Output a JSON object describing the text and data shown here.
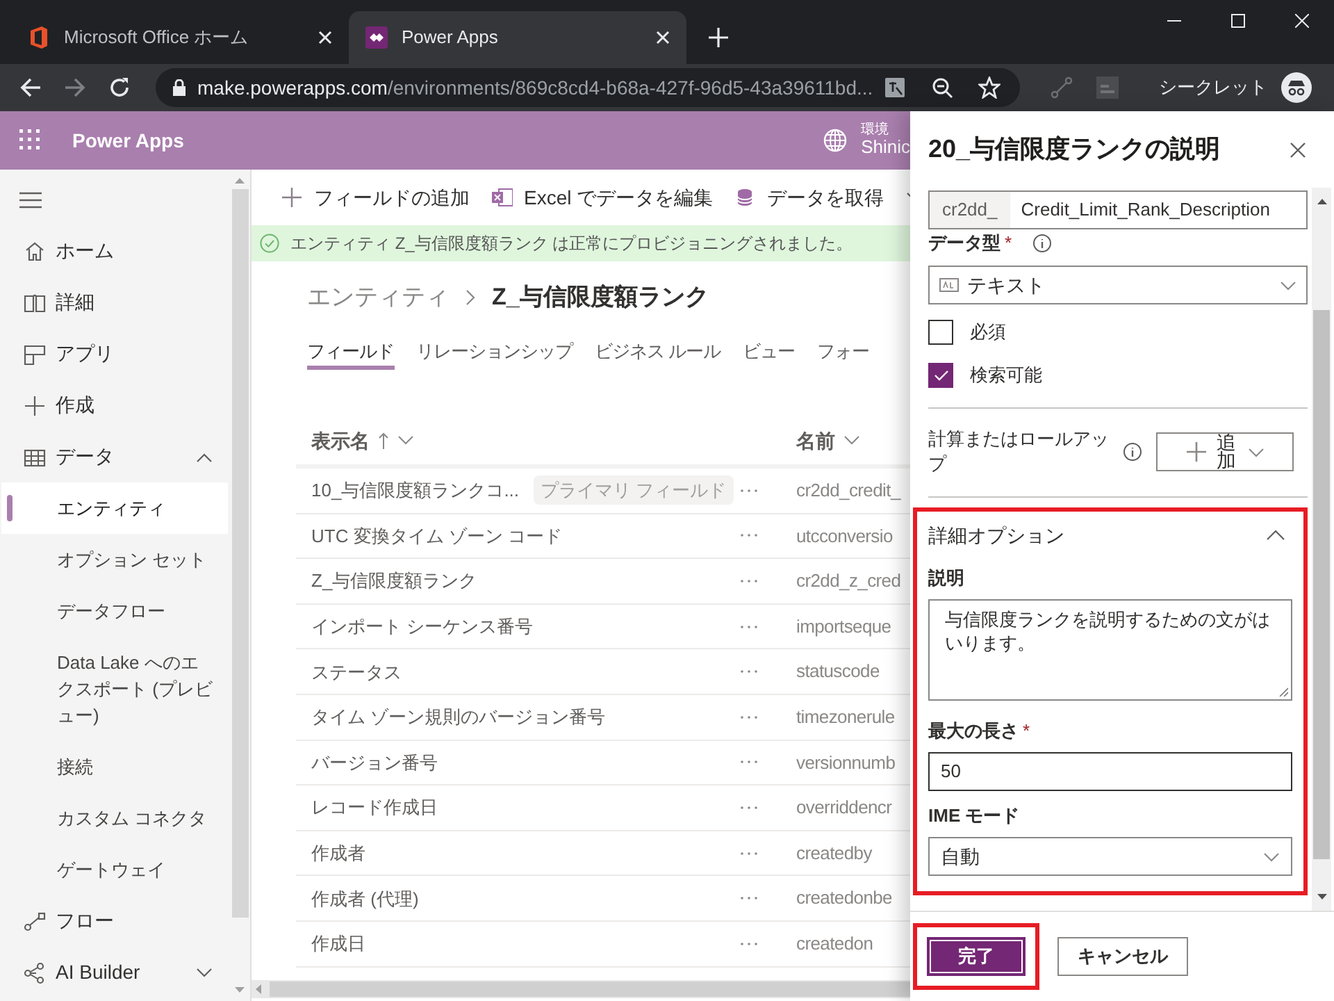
{
  "browser": {
    "tabs": [
      {
        "title": "Microsoft Office ホーム",
        "selected": false
      },
      {
        "title": "Power Apps",
        "selected": true
      }
    ],
    "url_host": "make.powerapps.com",
    "url_path": "/environments/869c8cd4-b68a-427f-96d5-43a39611bd...",
    "profile_label": "シークレット"
  },
  "app_bar": {
    "title": "Power Apps",
    "environment_label": "環境",
    "environment_name": "Shinic"
  },
  "sidebar": {
    "items": [
      {
        "label": "ホーム",
        "selected": false
      },
      {
        "label": "詳細",
        "selected": false
      },
      {
        "label": "アプリ",
        "selected": false
      },
      {
        "label": "作成",
        "selected": false
      },
      {
        "label": "データ",
        "selected": false,
        "expanded": true,
        "children": [
          {
            "label": "エンティティ",
            "selected": true
          },
          {
            "label": "オプション セット",
            "selected": false
          },
          {
            "label": "データフロー",
            "selected": false
          },
          {
            "label": "Data Lake へのエクスポート (プレビュー)",
            "selected": false
          },
          {
            "label": "接続",
            "selected": false
          },
          {
            "label": "カスタム コネクタ",
            "selected": false
          },
          {
            "label": "ゲートウェイ",
            "selected": false
          }
        ]
      },
      {
        "label": "フロー",
        "selected": false
      },
      {
        "label": "AI Builder",
        "selected": false,
        "expanded": false
      }
    ]
  },
  "command_bar": {
    "items": [
      {
        "label": "フィールドの追加"
      },
      {
        "label": "Excel でデータを編集"
      },
      {
        "label": "データを取得"
      }
    ]
  },
  "notification": "エンティティ Z_与信限度額ランク は正常にプロビジョニングされました。",
  "breadcrumb": [
    "エンティティ",
    "Z_与信限度額ランク"
  ],
  "tabs": [
    {
      "label": "フィールド",
      "selected": true
    },
    {
      "label": "リレーションシップ",
      "selected": false
    },
    {
      "label": "ビジネス ルール",
      "selected": false
    },
    {
      "label": "ビュー",
      "selected": false
    },
    {
      "label": "フォー",
      "selected": false
    }
  ],
  "table": {
    "columns": [
      {
        "label": "表示名",
        "sorted": true
      },
      {
        "label": "名前",
        "sorted": false
      }
    ],
    "rows": [
      {
        "display_name": "10_与信限度額ランクコ...",
        "badge": "プライマリ フィールド",
        "name": "cr2dd_credit_"
      },
      {
        "display_name": "UTC 変換タイム ゾーン コード",
        "name": "utcconversio"
      },
      {
        "display_name": "Z_与信限度額ランク",
        "name": "cr2dd_z_cred"
      },
      {
        "display_name": "インポート シーケンス番号",
        "name": "importseque"
      },
      {
        "display_name": "ステータス",
        "name": "statuscode"
      },
      {
        "display_name": "タイム ゾーン規則のバージョン番号",
        "name": "timezonerule"
      },
      {
        "display_name": "バージョン番号",
        "name": "versionnumb"
      },
      {
        "display_name": "レコード作成日",
        "name": "overriddencr"
      },
      {
        "display_name": "作成者",
        "name": "createdby"
      },
      {
        "display_name": "作成者 (代理)",
        "name": "createdonbe"
      },
      {
        "display_name": "作成日",
        "name": "createdon"
      }
    ]
  },
  "panel": {
    "title": "20_与信限度ランクの説明",
    "name_prefix": "cr2dd_",
    "name_value": "Credit_Limit_Rank_Description",
    "data_type_label": "データ型",
    "data_type_required": "*",
    "data_type_value": "テキスト",
    "checkboxes": [
      {
        "label": "必須",
        "checked": false
      },
      {
        "label": "検索可能",
        "checked": true
      }
    ],
    "calculated_label": "計算またはロールアップ",
    "add_button": "追加",
    "advanced": {
      "title": "詳細オプション",
      "expanded": true,
      "highlighted": true,
      "description_label": "説明",
      "description_value": "与信限度ランクを説明するための文がはいります。",
      "max_length_label": "最大の長さ",
      "max_length_required": "*",
      "max_length_value": "50",
      "ime_label": "IME モード",
      "ime_value": "自動"
    },
    "buttons": [
      {
        "label": "完了",
        "kind": "primary",
        "highlighted": true
      },
      {
        "label": "キャンセル",
        "kind": "secondary",
        "highlighted": false
      }
    ]
  }
}
